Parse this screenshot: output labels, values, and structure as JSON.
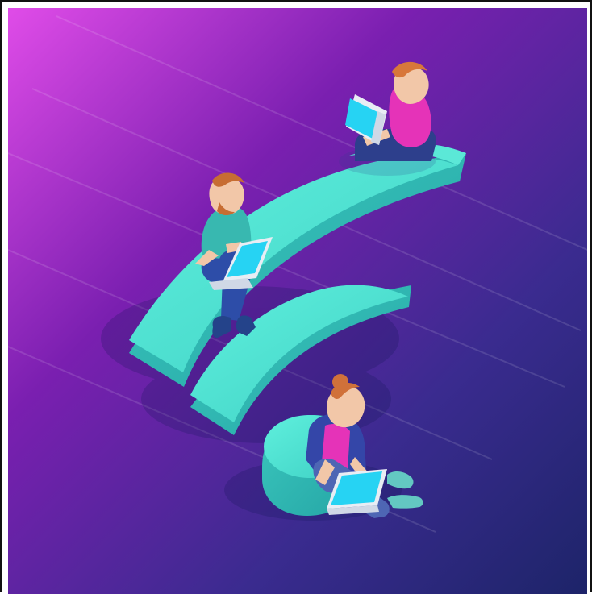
{
  "image": {
    "subject": "isometric-wifi-illustration",
    "background_gradient": [
      "#e04ce8",
      "#7a1fb0",
      "#3a2b8f",
      "#1d2469"
    ],
    "wifi_colors": {
      "top": "#4ee0cf",
      "side": "#2fb7b0",
      "shadow": "#1f8f95"
    },
    "people": [
      {
        "name": "man-on-outer-arc",
        "shirt": "#e533b8",
        "pants": "#2d3f8c",
        "hair": "#d8773a"
      },
      {
        "name": "man-on-middle-arc",
        "shirt": "#38b8b0",
        "pants": "#2d4da8",
        "hair": "#c76d33"
      },
      {
        "name": "woman-by-dot",
        "shirt": "#e533b8",
        "jacket": "#3446a8",
        "pants": "#4e66b4",
        "hair": "#d0713a"
      }
    ]
  }
}
